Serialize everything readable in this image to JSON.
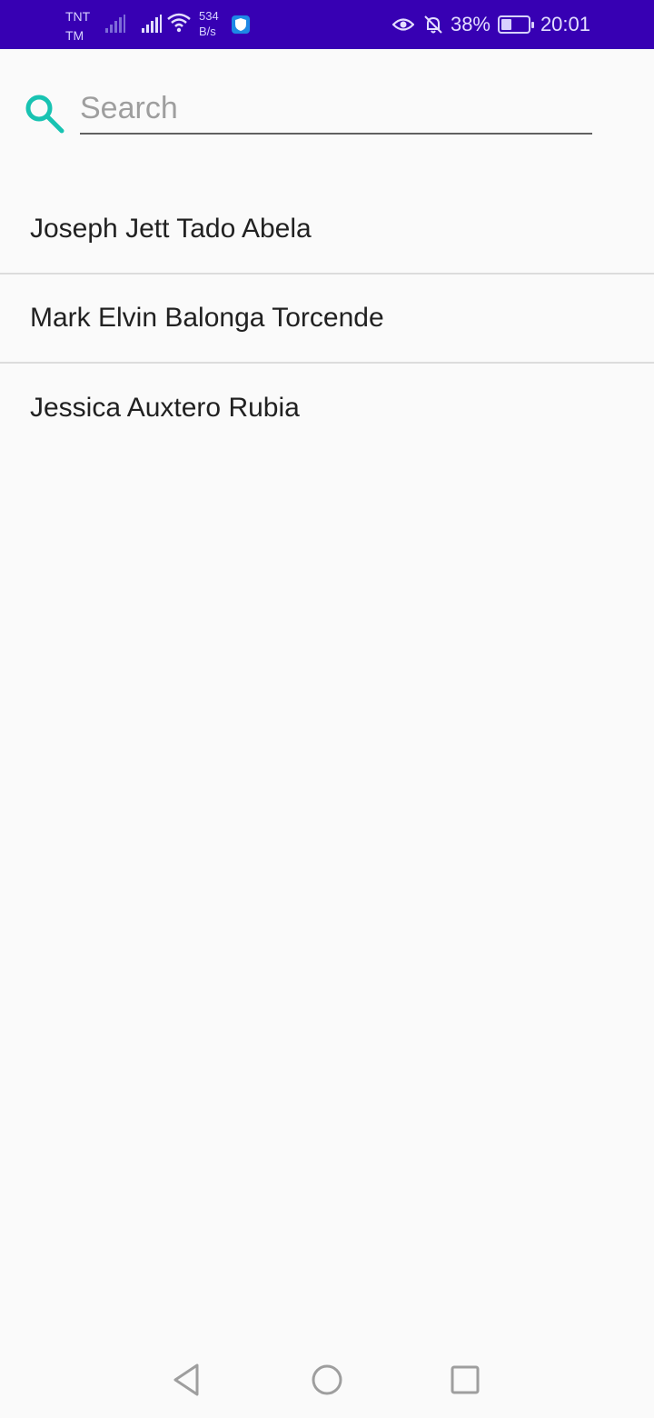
{
  "status_bar": {
    "carrier_line1": "TNT",
    "carrier_line2": "TM",
    "speed_value": "534",
    "speed_unit": "B/s",
    "battery_percent": "38%",
    "battery_level": 0.38,
    "time": "20:01",
    "icons": [
      "signal-icon",
      "wifi-icon",
      "shield-app-icon",
      "eye-icon",
      "bell-off-icon",
      "battery-icon"
    ],
    "background": "#3700b3"
  },
  "search": {
    "placeholder": "Search",
    "value": "",
    "icon": "search-icon",
    "accent_color": "#18c3b2"
  },
  "contacts": [
    {
      "name": "Joseph Jett Tado Abela"
    },
    {
      "name": "Mark Elvin Balonga Torcende"
    },
    {
      "name": "Jessica Auxtero Rubia"
    }
  ],
  "navigation": {
    "icons": [
      "back-icon",
      "home-icon",
      "recent-apps-icon"
    ]
  }
}
